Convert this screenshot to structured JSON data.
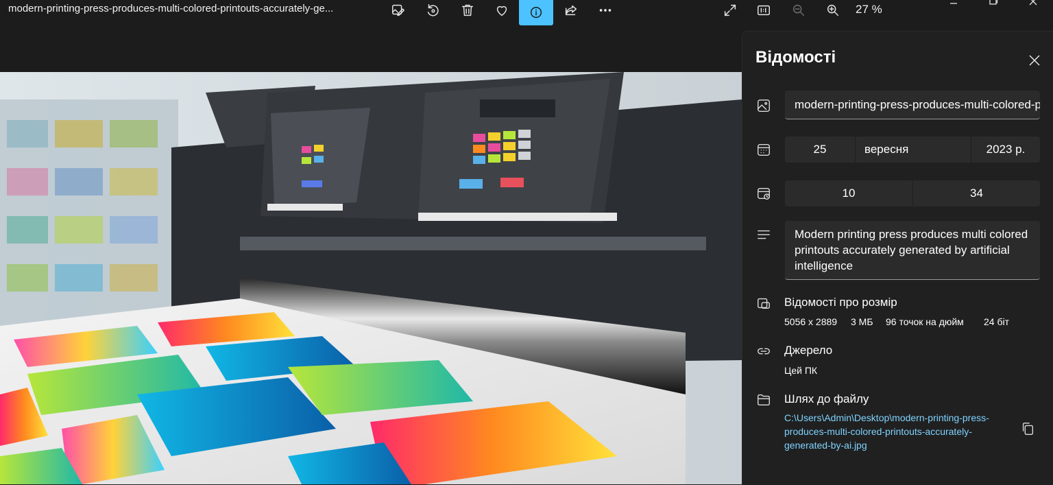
{
  "titlebar": {
    "filename": "modern-printing-press-produces-multi-colored-printouts-accurately-ge...",
    "zoom_level": "27 %"
  },
  "toolbar_icons": [
    "edit-image-icon",
    "rotate-icon",
    "delete-icon",
    "favorite-icon",
    "info-icon",
    "share-icon",
    "more-icon",
    "fullscreen-icon",
    "actual-size-icon",
    "zoom-out-icon",
    "zoom-in-icon"
  ],
  "window_controls": [
    "minimize-icon",
    "maximize-icon",
    "close-icon"
  ],
  "panel": {
    "title": "Відомості",
    "file_title_value": "modern-printing-press-produces-multi-colored-printouts-accurately-generated-by-ai",
    "date": {
      "day": "25",
      "month": "вересня",
      "year": "2023 р."
    },
    "time": {
      "hour": "10",
      "minute": "34"
    },
    "description": "Modern printing press produces multi colored printouts accurately generated by artificial intelligence",
    "size": {
      "label": "Відомості про розмір",
      "dimensions": "5056 x 2889",
      "file_size": "3 МБ",
      "dpi": "96 точок на дюйм",
      "bit_depth": "24 біт"
    },
    "source": {
      "label": "Джерело",
      "value": "Цей ПК"
    },
    "path": {
      "label": "Шлях до файлу",
      "value": "C:\\Users\\Admin\\Desktop\\modern-printing-press-produces-multi-colored-printouts-accurately-generated-by-ai.jpg"
    }
  },
  "colors": {
    "accent": "#4cc2ff",
    "link": "#7fd3ff",
    "panel_bg": "#202020",
    "app_bg": "#1c1c1c"
  }
}
